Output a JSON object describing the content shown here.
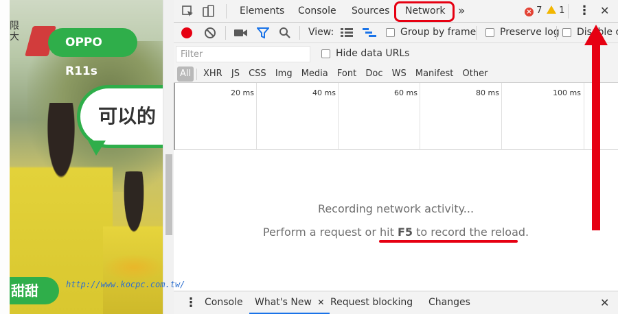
{
  "video": {
    "brand_label": "OPPO R11s",
    "bubble_text": "可以的",
    "bottom_tag": "甜甜",
    "side_text": "限大",
    "watermark_url": "http://www.kocpc.com.tw/"
  },
  "devtools": {
    "tabs": [
      "Elements",
      "Console",
      "Sources",
      "Network"
    ],
    "active_tab": "Network",
    "more_tabs_glyph": "»",
    "error_count": "7",
    "warning_count": "1",
    "error_glyph": "×",
    "warning_glyph": "!",
    "kebab_glyph": "⋮",
    "close_glyph": "✕",
    "toolbar": {
      "view_label": "View:",
      "group_by_frame": "Group by frame",
      "preserve_log": "Preserve log",
      "disable_cache": "Disable cache"
    },
    "filter": {
      "placeholder": "Filter",
      "hide_data_urls": "Hide data URLs",
      "all": "All",
      "types": [
        "XHR",
        "JS",
        "CSS",
        "Img",
        "Media",
        "Font",
        "Doc",
        "WS",
        "Manifest",
        "Other"
      ]
    },
    "overview_ticks": [
      "20 ms",
      "40 ms",
      "60 ms",
      "80 ms",
      "100 ms"
    ],
    "empty": {
      "line1": "Recording network activity...",
      "line2_prefix": "Perform a request or hit ",
      "line2_key": "F5",
      "line2_suffix": " to record the reload."
    },
    "drawer": {
      "tabs": [
        "Console",
        "What's New",
        "Request blocking",
        "Changes"
      ],
      "active_tab": "What's New",
      "tab_close_glyph": "✕",
      "close_glyph": "✕",
      "menu_glyph": "⋮"
    },
    "colors": {
      "record": "#e60012",
      "annotation": "#e60012",
      "filter_icon": "#1a73e8",
      "error": "#e34234",
      "warning": "#f2b600"
    }
  }
}
